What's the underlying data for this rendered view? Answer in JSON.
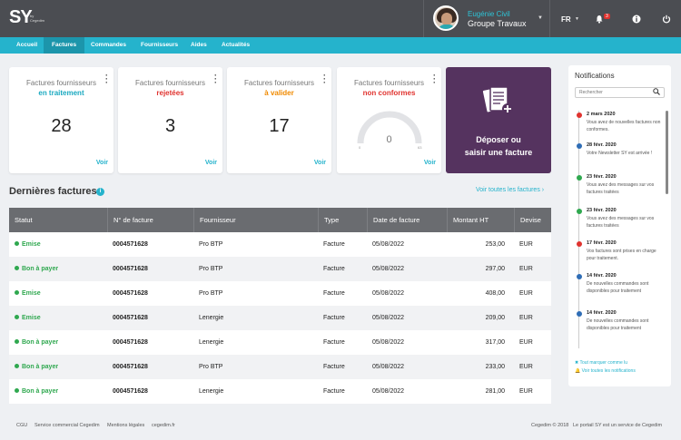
{
  "header": {
    "logo": "SY",
    "logo_by_line1": "by",
    "logo_by_line2": "Cegedim",
    "user_name": "Eugénie Civil",
    "user_org": "Groupe Travaux",
    "language": "FR",
    "notification_count": "3"
  },
  "nav": [
    "Accueil",
    "Factures",
    "Commandes",
    "Fournisseurs",
    "Aides",
    "Actualités"
  ],
  "cards": [
    {
      "title": "Factures fournisseurs",
      "subtitle": "en traitement",
      "value": "28",
      "link": "Voir",
      "color": "#1aa9c0"
    },
    {
      "title": "Factures fournisseurs",
      "subtitle": "rejetées",
      "value": "3",
      "link": "Voir",
      "color": "#e0332f"
    },
    {
      "title": "Factures fournisseurs",
      "subtitle": "à valider",
      "value": "17",
      "link": "Voir",
      "color": "#f08a00"
    },
    {
      "title": "Factures fournisseurs",
      "subtitle": "non conformes",
      "value": "0",
      "link": "Voir",
      "color": "#e0332f",
      "gauge_min": "0",
      "gauge_max": "63"
    }
  ],
  "deposit": {
    "line1": "Déposer ou",
    "line2": "saisir une facture"
  },
  "invoices": {
    "title": "Dernières factures",
    "see_all": "Voir toutes les factures ›",
    "columns": [
      "Statut",
      "N° de facture",
      "Fournisseur",
      "Type",
      "Date de facture",
      "Montant HT",
      "Devise"
    ],
    "rows": [
      {
        "status": "Emise",
        "number": "0004571628",
        "supplier": "Pro BTP",
        "type": "Facture",
        "date": "05/08/2022",
        "amount": "253,00",
        "currency": "EUR"
      },
      {
        "status": "Bon à payer",
        "number": "0004571628",
        "supplier": "Pro BTP",
        "type": "Facture",
        "date": "05/08/2022",
        "amount": "297,00",
        "currency": "EUR"
      },
      {
        "status": "Emise",
        "number": "0004571628",
        "supplier": "Pro BTP",
        "type": "Facture",
        "date": "05/08/2022",
        "amount": "408,00",
        "currency": "EUR"
      },
      {
        "status": "Emise",
        "number": "0004571628",
        "supplier": "Lenergie",
        "type": "Facture",
        "date": "05/08/2022",
        "amount": "209,00",
        "currency": "EUR"
      },
      {
        "status": "Bon à payer",
        "number": "0004571628",
        "supplier": "Lenergie",
        "type": "Facture",
        "date": "05/08/2022",
        "amount": "317,00",
        "currency": "EUR"
      },
      {
        "status": "Bon à payer",
        "number": "0004571628",
        "supplier": "Pro BTP",
        "type": "Facture",
        "date": "05/08/2022",
        "amount": "233,00",
        "currency": "EUR"
      },
      {
        "status": "Bon à payer",
        "number": "0004571628",
        "supplier": "Lenergie",
        "type": "Facture",
        "date": "05/08/2022",
        "amount": "281,00",
        "currency": "EUR"
      }
    ]
  },
  "notifications": {
    "title": "Notifications",
    "search_placeholder": "Rechercher",
    "items": [
      {
        "date": "2 mars 2020",
        "text": "Vous avez de nouvelles factures non conformes.",
        "color": "#e0332f"
      },
      {
        "date": "28 févr. 2020",
        "text": "Votre Newsletter SY est arrivée !",
        "color": "#2f6db5"
      },
      {
        "date": "23 févr. 2020",
        "text": "Vous avez des messages sur vos factures traitées",
        "color": "#2fa84f"
      },
      {
        "date": "23 févr. 2020",
        "text": "Vous avez des messages sur vos factures traitées",
        "color": "#2fa84f"
      },
      {
        "date": "17 févr. 2020",
        "text": "Vos factures sont prises en charge pour traitement.",
        "color": "#e0332f"
      },
      {
        "date": "14 févr. 2020",
        "text": "De nouvelles commandes sont disponibles pour traitement",
        "color": "#2f6db5"
      },
      {
        "date": "14 févr. 2020",
        "text": "De nouvelles commandes sont disponibles pour traitement",
        "color": "#2f6db5"
      }
    ],
    "mark_all": "✖ Tout marquer comme lu",
    "see_all": "🔔 Voir toutes les notifications"
  },
  "footer": {
    "links": [
      "CGU",
      "Service commercial Cegedim",
      "Mentions légales",
      "cegedim.fr"
    ],
    "copyright": "Cegedim © 2018",
    "tagline": "Le portail SY est un service de Cegedim"
  }
}
